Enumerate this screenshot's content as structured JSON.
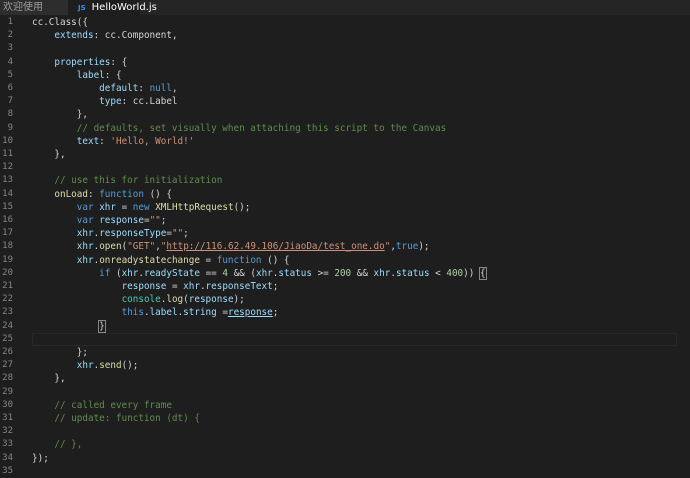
{
  "tabs": [
    {
      "label": "欢迎使用"
    },
    {
      "label": "HelloWorld.js",
      "icon": "JS"
    }
  ],
  "colors": {
    "background": "#1e1e1e",
    "keyword": "#569cd6",
    "string": "#ce9178",
    "comment": "#608b4e",
    "number": "#b5cea8",
    "function": "#dcdcaa",
    "property": "#9cdcfe"
  },
  "lines": [
    {
      "n": "1",
      "tokens": [
        [
          "plain",
          "cc.Class({"
        ]
      ]
    },
    {
      "n": "2",
      "tokens": [
        [
          "plain",
          "    "
        ],
        [
          "prop",
          "extends"
        ],
        [
          "plain",
          ": cc.Component,"
        ]
      ]
    },
    {
      "n": "3",
      "tokens": []
    },
    {
      "n": "4",
      "tokens": [
        [
          "plain",
          "    "
        ],
        [
          "prop",
          "properties"
        ],
        [
          "plain",
          ": {"
        ]
      ]
    },
    {
      "n": "5",
      "tokens": [
        [
          "plain",
          "        "
        ],
        [
          "prop",
          "label"
        ],
        [
          "plain",
          ": {"
        ]
      ]
    },
    {
      "n": "6",
      "tokens": [
        [
          "plain",
          "            "
        ],
        [
          "prop",
          "default"
        ],
        [
          "plain",
          ": "
        ],
        [
          "kw",
          "null"
        ],
        [
          "plain",
          ","
        ]
      ]
    },
    {
      "n": "7",
      "tokens": [
        [
          "plain",
          "            "
        ],
        [
          "prop",
          "type"
        ],
        [
          "plain",
          ": cc.Label"
        ]
      ]
    },
    {
      "n": "8",
      "tokens": [
        [
          "plain",
          "        },"
        ]
      ]
    },
    {
      "n": "9",
      "tokens": [
        [
          "plain",
          "        "
        ],
        [
          "cm",
          "// defaults, set visually when attaching this script to the Canvas"
        ]
      ]
    },
    {
      "n": "10",
      "tokens": [
        [
          "plain",
          "        "
        ],
        [
          "prop",
          "text"
        ],
        [
          "plain",
          ": "
        ],
        [
          "str",
          "'Hello, World!'"
        ]
      ]
    },
    {
      "n": "11",
      "tokens": [
        [
          "plain",
          "    },"
        ]
      ]
    },
    {
      "n": "12",
      "tokens": []
    },
    {
      "n": "13",
      "tokens": [
        [
          "plain",
          "    "
        ],
        [
          "cm",
          "// use this for initialization"
        ]
      ]
    },
    {
      "n": "14",
      "tokens": [
        [
          "plain",
          "    "
        ],
        [
          "fn",
          "onLoad"
        ],
        [
          "plain",
          ": "
        ],
        [
          "kw",
          "function"
        ],
        [
          "plain",
          " () {"
        ]
      ]
    },
    {
      "n": "15",
      "tokens": [
        [
          "plain",
          "        "
        ],
        [
          "kw",
          "var"
        ],
        [
          "plain",
          " "
        ],
        [
          "prop",
          "xhr"
        ],
        [
          "plain",
          " = "
        ],
        [
          "kw",
          "new"
        ],
        [
          "plain",
          " "
        ],
        [
          "fn",
          "XMLHttpRequest"
        ],
        [
          "plain",
          "();"
        ]
      ]
    },
    {
      "n": "16",
      "tokens": [
        [
          "plain",
          "        "
        ],
        [
          "kw",
          "var"
        ],
        [
          "plain",
          " "
        ],
        [
          "prop",
          "response"
        ],
        [
          "plain",
          "="
        ],
        [
          "str",
          "\"\""
        ],
        [
          "plain",
          ";"
        ]
      ]
    },
    {
      "n": "17",
      "tokens": [
        [
          "plain",
          "        "
        ],
        [
          "prop",
          "xhr"
        ],
        [
          "plain",
          "."
        ],
        [
          "prop",
          "responseType"
        ],
        [
          "plain",
          "="
        ],
        [
          "str",
          "\"\""
        ],
        [
          "plain",
          ";"
        ]
      ]
    },
    {
      "n": "18",
      "tokens": [
        [
          "plain",
          "        "
        ],
        [
          "prop",
          "xhr"
        ],
        [
          "plain",
          "."
        ],
        [
          "fn",
          "open"
        ],
        [
          "plain",
          "("
        ],
        [
          "str",
          "\"GET\""
        ],
        [
          "plain",
          ","
        ],
        [
          "str",
          "\""
        ],
        [
          "url",
          "http://116.62.49.106/JiaoDa/test_one.do"
        ],
        [
          "str",
          "\""
        ],
        [
          "plain",
          ","
        ],
        [
          "kw",
          "true"
        ],
        [
          "plain",
          ");"
        ]
      ]
    },
    {
      "n": "19",
      "tokens": [
        [
          "plain",
          "        "
        ],
        [
          "prop",
          "xhr"
        ],
        [
          "plain",
          "."
        ],
        [
          "fn",
          "onreadystatechange"
        ],
        [
          "plain",
          " = "
        ],
        [
          "kw",
          "function"
        ],
        [
          "plain",
          " () {"
        ]
      ]
    },
    {
      "n": "20",
      "tokens": [
        [
          "plain",
          "            "
        ],
        [
          "kw",
          "if"
        ],
        [
          "plain",
          " ("
        ],
        [
          "prop",
          "xhr"
        ],
        [
          "plain",
          "."
        ],
        [
          "prop",
          "readyState"
        ],
        [
          "plain",
          " == "
        ],
        [
          "num",
          "4"
        ],
        [
          "plain",
          " && ("
        ],
        [
          "prop",
          "xhr"
        ],
        [
          "plain",
          "."
        ],
        [
          "prop",
          "status"
        ],
        [
          "plain",
          " >= "
        ],
        [
          "num",
          "200"
        ],
        [
          "plain",
          " && "
        ],
        [
          "prop",
          "xhr"
        ],
        [
          "plain",
          "."
        ],
        [
          "prop",
          "status"
        ],
        [
          "plain",
          " < "
        ],
        [
          "num",
          "400"
        ],
        [
          "plain",
          ")) "
        ],
        [
          "brk",
          "{"
        ]
      ]
    },
    {
      "n": "21",
      "tokens": [
        [
          "plain",
          "                "
        ],
        [
          "prop",
          "response"
        ],
        [
          "plain",
          " = "
        ],
        [
          "prop",
          "xhr"
        ],
        [
          "plain",
          "."
        ],
        [
          "prop",
          "responseText"
        ],
        [
          "plain",
          ";"
        ]
      ]
    },
    {
      "n": "22",
      "tokens": [
        [
          "plain",
          "                "
        ],
        [
          "cls",
          "console"
        ],
        [
          "plain",
          "."
        ],
        [
          "fn",
          "log"
        ],
        [
          "plain",
          "("
        ],
        [
          "prop",
          "response"
        ],
        [
          "plain",
          ");"
        ]
      ]
    },
    {
      "n": "23",
      "tokens": [
        [
          "plain",
          "                "
        ],
        [
          "kw",
          "this"
        ],
        [
          "plain",
          "."
        ],
        [
          "prop",
          "label"
        ],
        [
          "plain",
          "."
        ],
        [
          "prop",
          "string"
        ],
        [
          "plain",
          " ="
        ],
        [
          "link",
          "response"
        ],
        [
          "plain",
          ";"
        ]
      ]
    },
    {
      "n": "24",
      "tokens": [
        [
          "plain",
          "            "
        ],
        [
          "brk",
          "}"
        ]
      ]
    },
    {
      "n": "25",
      "tokens": []
    },
    {
      "n": "26",
      "tokens": [
        [
          "plain",
          "        };"
        ]
      ]
    },
    {
      "n": "27",
      "tokens": [
        [
          "plain",
          "        "
        ],
        [
          "prop",
          "xhr"
        ],
        [
          "plain",
          "."
        ],
        [
          "fn",
          "send"
        ],
        [
          "plain",
          "();"
        ]
      ]
    },
    {
      "n": "28",
      "tokens": [
        [
          "plain",
          "    },"
        ]
      ]
    },
    {
      "n": "29",
      "tokens": []
    },
    {
      "n": "30",
      "tokens": [
        [
          "plain",
          "    "
        ],
        [
          "cm",
          "// called every frame"
        ]
      ]
    },
    {
      "n": "31",
      "tokens": [
        [
          "plain",
          "    "
        ],
        [
          "cm",
          "// update: function (dt) {"
        ]
      ]
    },
    {
      "n": "32",
      "tokens": []
    },
    {
      "n": "33",
      "tokens": [
        [
          "plain",
          "    "
        ],
        [
          "cm",
          "// },"
        ]
      ]
    },
    {
      "n": "34",
      "tokens": [
        [
          "plain",
          "});"
        ]
      ]
    },
    {
      "n": "35",
      "tokens": []
    }
  ]
}
